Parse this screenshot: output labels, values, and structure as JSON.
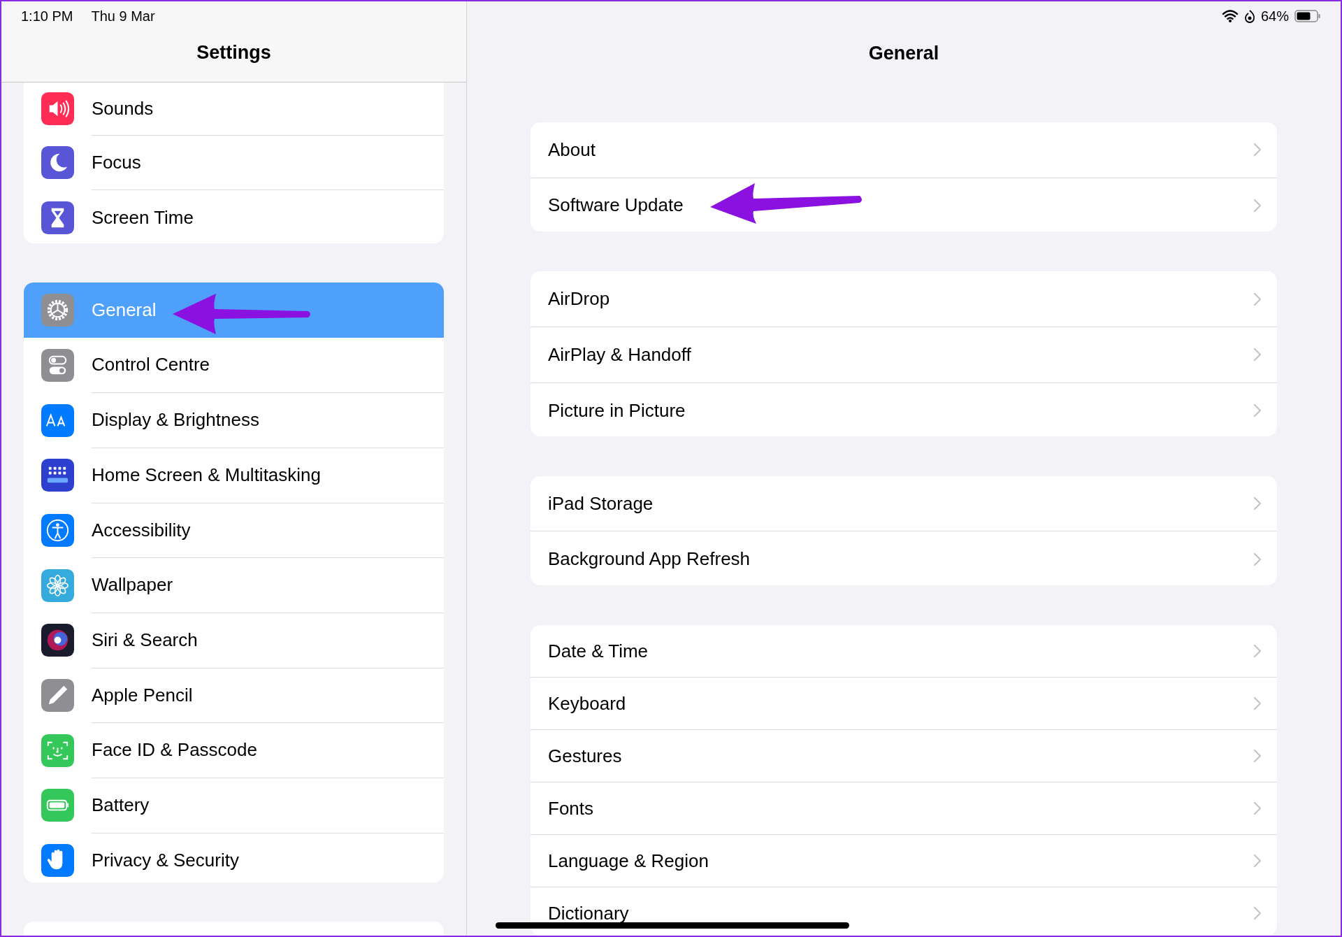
{
  "status_bar": {
    "time": "1:10 PM",
    "date": "Thu 9 Mar",
    "battery_percent": "64%"
  },
  "sidebar": {
    "title": "Settings",
    "groups": [
      {
        "items": [
          {
            "label": "Sounds",
            "selected": false
          },
          {
            "label": "Focus",
            "selected": false
          },
          {
            "label": "Screen Time",
            "selected": false
          }
        ]
      },
      {
        "items": [
          {
            "label": "General",
            "selected": true
          },
          {
            "label": "Control Centre",
            "selected": false
          },
          {
            "label": "Display & Brightness",
            "selected": false
          },
          {
            "label": "Home Screen & Multitasking",
            "selected": false
          },
          {
            "label": "Accessibility",
            "selected": false
          },
          {
            "label": "Wallpaper",
            "selected": false
          },
          {
            "label": "Siri & Search",
            "selected": false
          },
          {
            "label": "Apple Pencil",
            "selected": false
          },
          {
            "label": "Face ID & Passcode",
            "selected": false
          },
          {
            "label": "Battery",
            "selected": false
          },
          {
            "label": "Privacy & Security",
            "selected": false
          }
        ]
      }
    ]
  },
  "detail": {
    "title": "General",
    "groups": [
      {
        "items": [
          {
            "label": "About"
          },
          {
            "label": "Software Update"
          }
        ]
      },
      {
        "items": [
          {
            "label": "AirDrop"
          },
          {
            "label": "AirPlay & Handoff"
          },
          {
            "label": "Picture in Picture"
          }
        ]
      },
      {
        "items": [
          {
            "label": "iPad Storage"
          },
          {
            "label": "Background App Refresh"
          }
        ]
      },
      {
        "items": [
          {
            "label": "Date & Time"
          },
          {
            "label": "Keyboard"
          },
          {
            "label": "Gestures"
          },
          {
            "label": "Fonts"
          },
          {
            "label": "Language & Region"
          },
          {
            "label": "Dictionary"
          }
        ]
      }
    ]
  }
}
